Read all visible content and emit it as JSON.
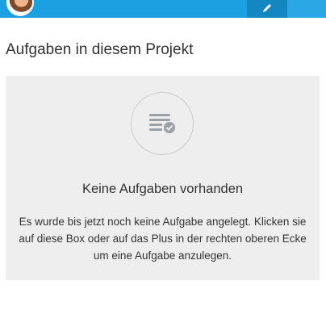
{
  "header": {
    "avatar_alt": "user avatar",
    "edit_icon": "pencil-icon",
    "accent_color": "#1ba1e2"
  },
  "section": {
    "title": "Aufgaben in diesem Projekt"
  },
  "empty_state": {
    "icon": "task-list-check-icon",
    "heading": "Keine Aufgaben vorhanden",
    "text": "Es wurde bis jetzt noch keine Aufgabe angelegt. Klicken sie auf diese Box oder auf das Plus in der rechten oberen Ecke um eine Aufgabe anzulegen."
  }
}
